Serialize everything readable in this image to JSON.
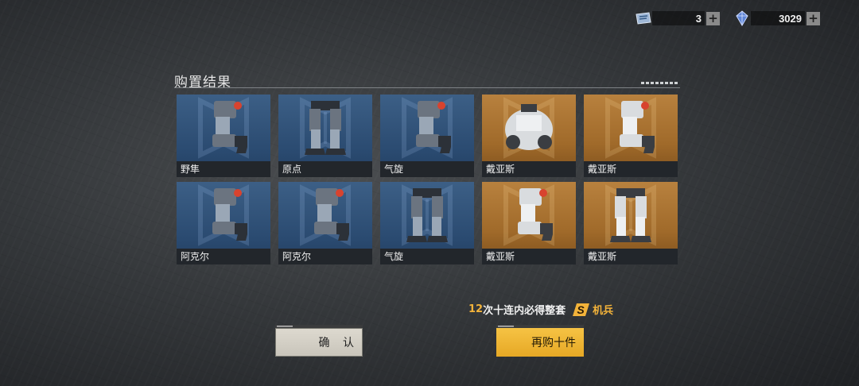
{
  "currency": {
    "first": {
      "icon": "ticket-icon",
      "value": "3"
    },
    "second": {
      "icon": "crystal-icon",
      "value": "3029"
    }
  },
  "title": "购置结果",
  "results": [
    {
      "name": "野隼",
      "rarity": "blue",
      "part": "arm"
    },
    {
      "name": "原点",
      "rarity": "blue",
      "part": "legs"
    },
    {
      "name": "气旋",
      "rarity": "blue",
      "part": "arm"
    },
    {
      "name": "戴亚斯",
      "rarity": "gold",
      "part": "torso"
    },
    {
      "name": "戴亚斯",
      "rarity": "gold",
      "part": "arm"
    },
    {
      "name": "阿克尔",
      "rarity": "blue",
      "part": "arm"
    },
    {
      "name": "阿克尔",
      "rarity": "blue",
      "part": "arm"
    },
    {
      "name": "气旋",
      "rarity": "blue",
      "part": "legs"
    },
    {
      "name": "戴亚斯",
      "rarity": "gold",
      "part": "arm"
    },
    {
      "name": "戴亚斯",
      "rarity": "gold",
      "part": "legs"
    }
  ],
  "promo": {
    "number": "12",
    "middle": "次十连内必得整套",
    "badge": "S",
    "suffix": "机兵"
  },
  "buttons": {
    "confirm": "确 认",
    "again": "再购十件"
  },
  "colors": {
    "accent": "#f3b33a",
    "blue_card": "#2f5279",
    "gold_card": "#a86f2e"
  }
}
